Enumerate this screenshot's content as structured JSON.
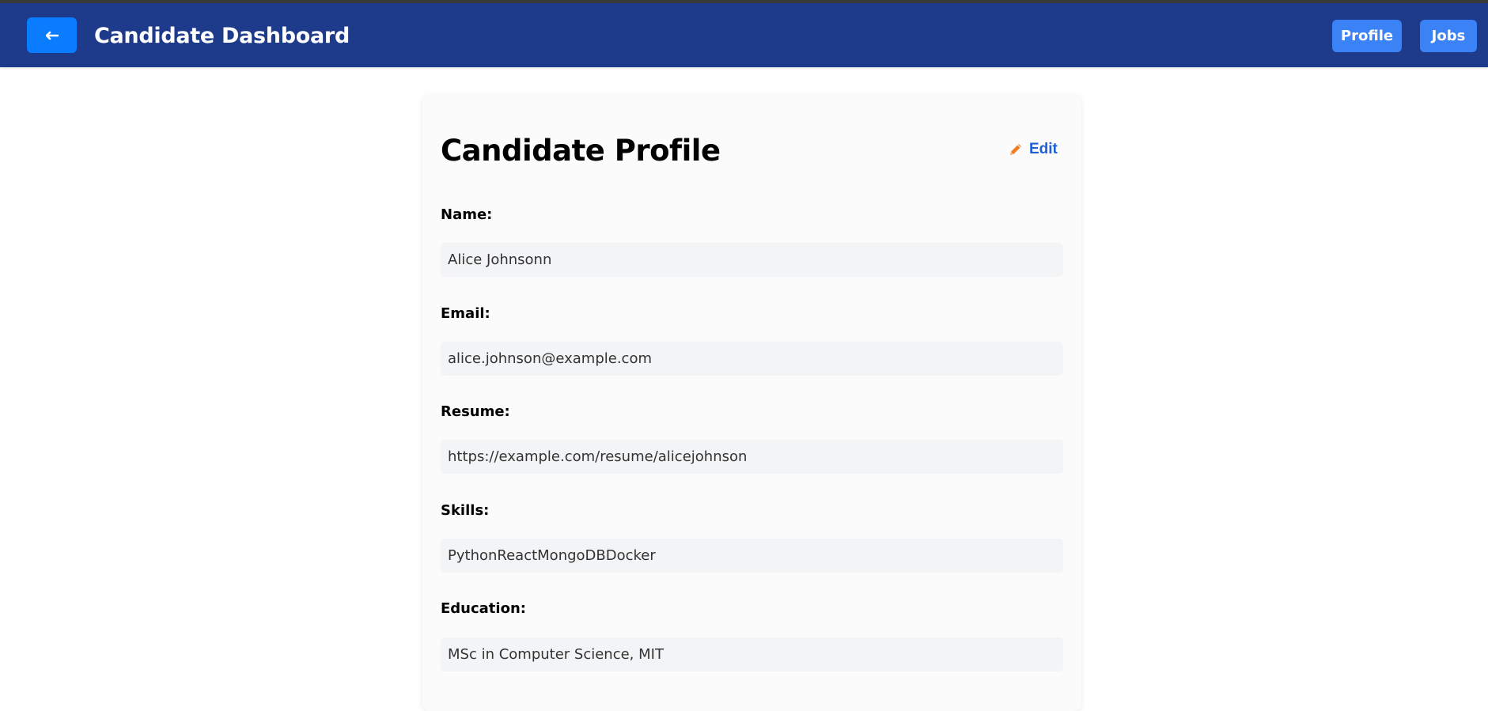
{
  "header": {
    "back_icon": "arrow-left-icon",
    "title": "Candidate Dashboard",
    "nav": [
      "Profile",
      "Jobs"
    ]
  },
  "profile": {
    "title": "Candidate Profile",
    "edit_icon": "pencil-icon",
    "edit_label": "Edit",
    "fields": [
      {
        "label": "Name:",
        "value": "Alice Johnsonn"
      },
      {
        "label": "Email:",
        "value": "alice.johnson@example.com"
      },
      {
        "label": "Resume:",
        "value": "https://example.com/resume/alicejohnson"
      },
      {
        "label": "Skills:",
        "value": "PythonReactMongoDBDocker"
      },
      {
        "label": "Education:",
        "value": "MSc in Computer Science, MIT"
      }
    ]
  },
  "colors": {
    "navbar": "#1e3a8a",
    "back_button": "#0a7cff",
    "nav_button": "#3b82f6",
    "edit_text": "#1d5fd6",
    "edit_icon": "#f07a1e",
    "field_bg": "#f3f4f6"
  }
}
